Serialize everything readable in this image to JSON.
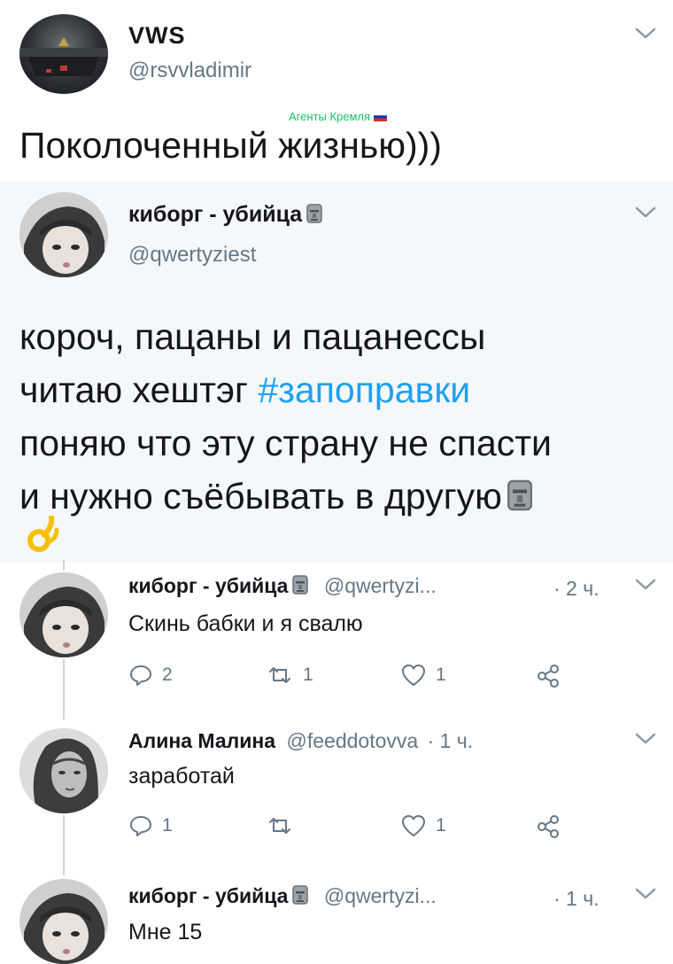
{
  "main_tweet": {
    "name": "VWS",
    "handle": "@rsvvladimir",
    "caption_badge": "Агенты Кремля",
    "text": "Поколоченный жизнью)))"
  },
  "quoted_tweet": {
    "name": "киборг - убийца",
    "handle": "@qwertyziest",
    "text_line1": "короч,  пацаны и пацанессы",
    "text_line2_prefix": "читаю хештэг",
    "hashtag": "#запоправки",
    "text_line3": "поняю что эту страну не спасти",
    "text_line4": "и нужно съёбывать в другую"
  },
  "replies": [
    {
      "name": "киборг - убийца",
      "handle": "@qwertyzi...",
      "time": "· 2 ч.",
      "text": "Скинь бабки и я свалю",
      "reply_count": "2",
      "retweet_count": "1",
      "like_count": "1"
    },
    {
      "name": "Алина Малина",
      "handle": "@feeddotovva",
      "time": "· 1 ч.",
      "text": "заработай",
      "reply_count": "1",
      "retweet_count": "",
      "like_count": "1"
    },
    {
      "name": "киборг - убийца",
      "handle": "@qwertyzi...",
      "time": "· 1 ч.",
      "text": "Мне 15"
    }
  ],
  "colors": {
    "link_blue": "#1da1f2",
    "muted_gray": "#657786",
    "thread_line": "#ccd6dd",
    "badge_green": "#17bf63",
    "quoted_bg": "#f5f8fa"
  }
}
